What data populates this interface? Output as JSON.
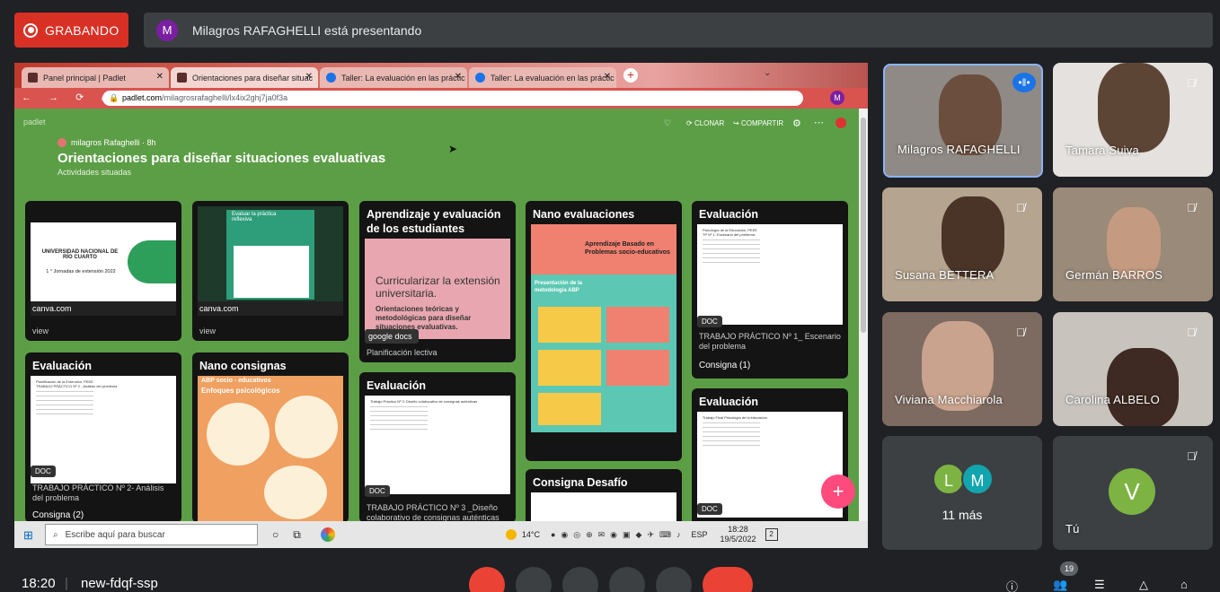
{
  "recording": {
    "label": "GRABANDO"
  },
  "presenting": {
    "avatar_letter": "M",
    "text": "Milagros RAFAGHELLI está presentando"
  },
  "browser": {
    "tabs": [
      {
        "label": "Panel principal | Padlet"
      },
      {
        "label": "Orientaciones para diseñar situac"
      },
      {
        "label": "Taller: La evaluación en las práctic"
      },
      {
        "label": "Taller: La evaluación en las práctic"
      }
    ],
    "url_host": "padlet.com",
    "url_path": "/milagrosrafaghelli/lx4ix2ghj7ja0f3a"
  },
  "padlet": {
    "brand": "padlet",
    "author": "milagros Rafaghelli",
    "time": "8h",
    "title": "Orientaciones para diseñar situaciones evaluativas",
    "subtitle": "Actividades situadas",
    "actions": {
      "clone": "CLONAR",
      "share": "COMPARTIR"
    },
    "cards": {
      "c1": {
        "thumb_title": "UNIVERSIDAD NACIONAL DE RÍO CUARTO",
        "thumb_sub": "1 ° Jornadas de extensión 2022",
        "source": "canva.com",
        "caption": "view"
      },
      "c2": {
        "thumb_title": "Evaluar la práctica reflexiva",
        "source": "canva.com",
        "caption": "view"
      },
      "c3": {
        "title": "Aprendizaje y evaluación de los estudiantes",
        "thumb_title": "Curricularizar la extensión universitaria.",
        "thumb_sub": "Orientaciones teóricas y metodológicas para diseñar situaciones evaluativas.",
        "source": "google docs",
        "caption": "Planificación lectiva"
      },
      "c4": {
        "title": "Nano evaluaciones",
        "thumb_title": "Aprendizaje Basado en Problemas socio-educativos",
        "thumb_sub": "Presentación de la metodología ABP"
      },
      "c5": {
        "title": "Evaluación",
        "badge": "DOC",
        "caption": "TRABAJO PRÁCTICO Nº 1_ Escenario del problema",
        "footer": "Consigna (1)"
      },
      "c6": {
        "title": "Evaluación",
        "badge": "DOC",
        "caption": "TRABAJO PRÁCTICO Nº 2- Análisis del problema",
        "footer": "Consigna (2)"
      },
      "c7": {
        "title": "Nano consignas",
        "thumb_title": "ABP socio - educativos",
        "thumb_sub": "Enfoques psicológicos"
      },
      "c8": {
        "title": "Evaluación",
        "badge": "DOC",
        "caption": "TRABAJO PRÁCTICO Nº 3 _Diseño colaborativo de consignas auténticas"
      },
      "c9": {
        "title": "Consigna Desafío"
      },
      "c10": {
        "title": "Evaluación",
        "badge": "DOC"
      }
    }
  },
  "taskbar": {
    "search_placeholder": "Escribe aquí para buscar",
    "weather": "14°C",
    "lang": "ESP",
    "time": "18:28",
    "date": "19/5/2022",
    "notif": "2"
  },
  "participants": [
    {
      "name": "Milagros RAFAGHELLI",
      "speaking": true
    },
    {
      "name": "Tamara Suiva"
    },
    {
      "name": "Susana BETTERA"
    },
    {
      "name": "Germán BARROS"
    },
    {
      "name": "Viviana Macchiarola"
    },
    {
      "name": "Carolina ALBELO"
    },
    {
      "name": "11 más",
      "letters": [
        "L",
        "M"
      ]
    },
    {
      "name": "Tú",
      "letter": "V"
    }
  ],
  "bottom_bar": {
    "clock": "18:20",
    "meeting_code": "new-fdqf-ssp",
    "people_count": "19"
  },
  "colors": {
    "record": "#d93025",
    "padlet_bg": "#5c9e46",
    "add_button": "#ff4a7d",
    "accent_speaking": "#8ab4f8"
  }
}
